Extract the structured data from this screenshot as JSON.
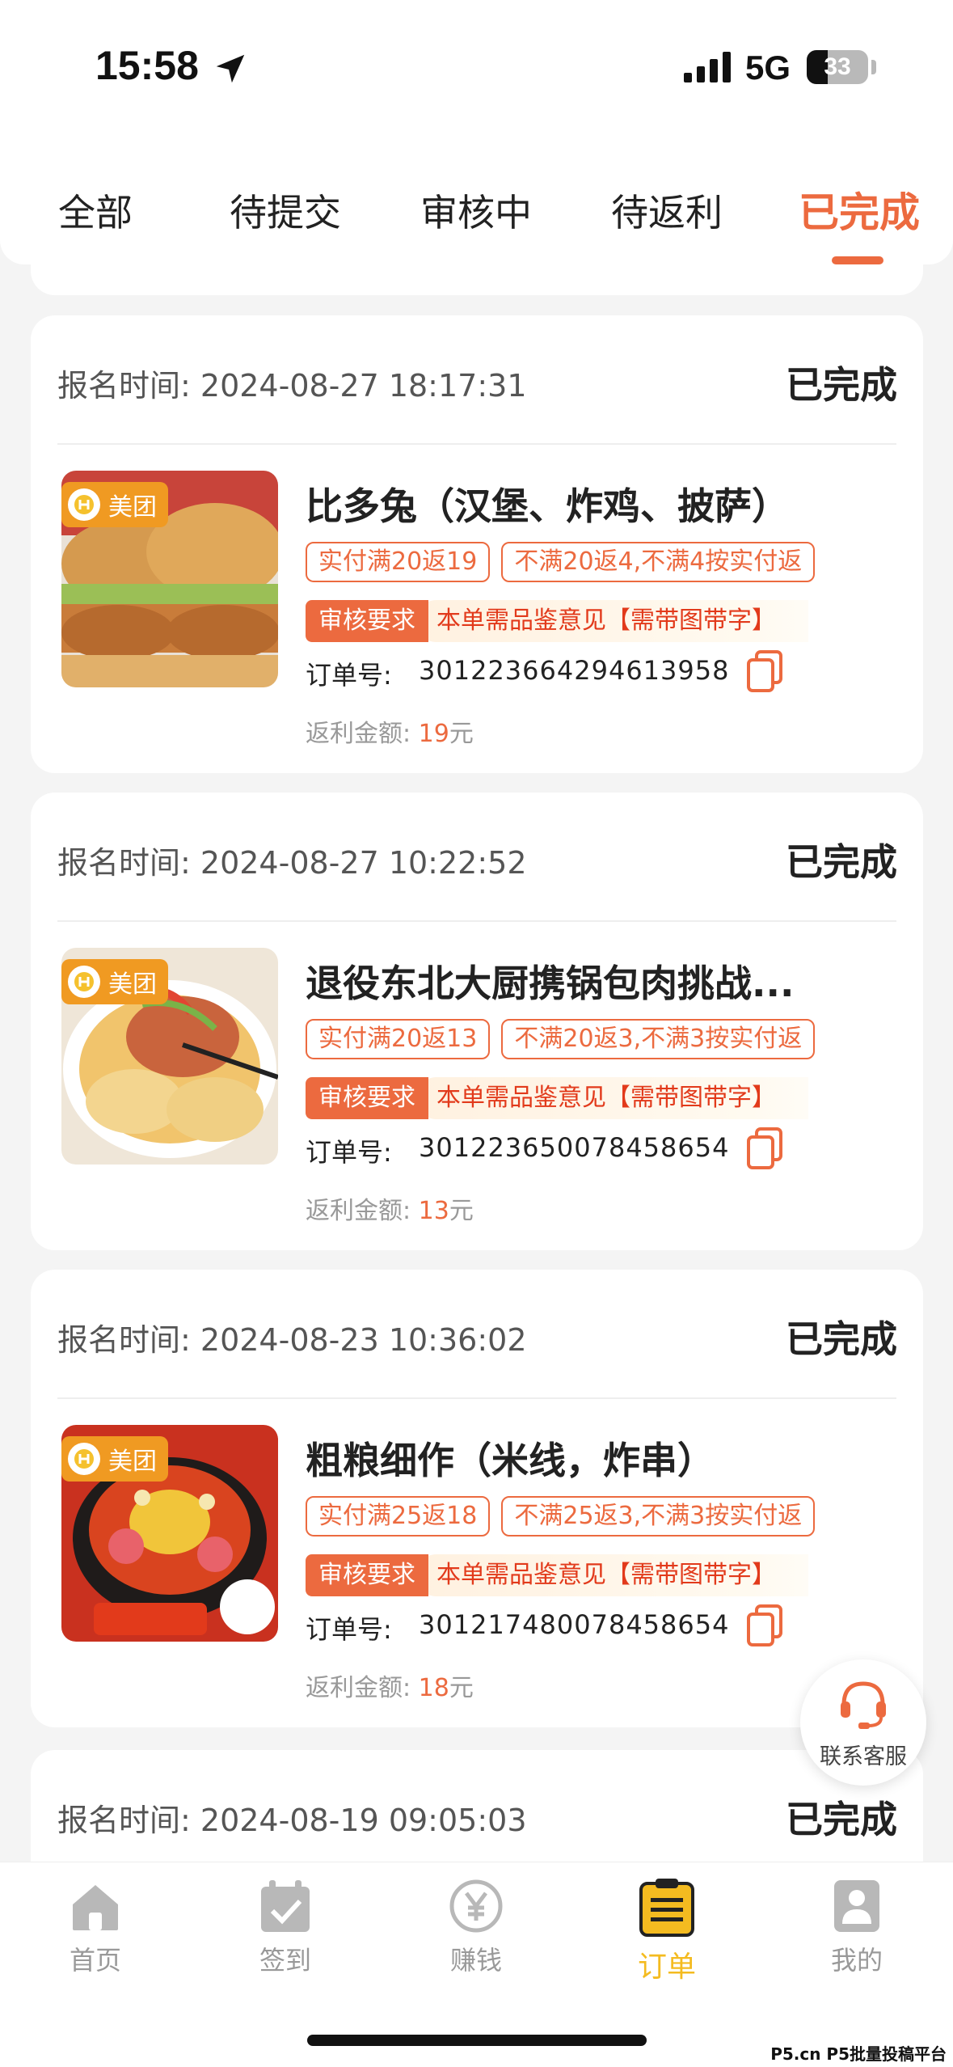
{
  "status_bar": {
    "time": "15:58",
    "network": "5G",
    "battery": "33"
  },
  "tabs": [
    {
      "label": "全部"
    },
    {
      "label": "待提交"
    },
    {
      "label": "审核中"
    },
    {
      "label": "待返利"
    },
    {
      "label": "已完成"
    }
  ],
  "active_tab": "已完成",
  "orders": [
    {
      "time_label": "报名时间:",
      "time": "2024-08-27 18:17:31",
      "status": "已完成",
      "platform": "美团",
      "title": "比多兔（汉堡、炸鸡、披萨）",
      "tag1": "实付满20返19",
      "tag2": "不满20返4,不满4按实付返",
      "req_label": "审核要求",
      "req_text": "本单需品鉴意见【需带图带字】",
      "order_label": "订单号:",
      "order_no": "301223664294613958",
      "rebate_label": "返利金额:",
      "rebate_amount": "19",
      "rebate_unit": "元"
    },
    {
      "time_label": "报名时间:",
      "time": "2024-08-27 10:22:52",
      "status": "已完成",
      "platform": "美团",
      "title": "退役东北大厨携锅包肉挑战...",
      "tag1": "实付满20返13",
      "tag2": "不满20返3,不满3按实付返",
      "req_label": "审核要求",
      "req_text": "本单需品鉴意见【需带图带字】",
      "order_label": "订单号:",
      "order_no": "301223650078458654",
      "rebate_label": "返利金额:",
      "rebate_amount": "13",
      "rebate_unit": "元"
    },
    {
      "time_label": "报名时间:",
      "time": "2024-08-23 10:36:02",
      "status": "已完成",
      "platform": "美团",
      "title": "粗粮细作（米线，炸串）",
      "tag1": "实付满25返18",
      "tag2": "不满25返3,不满3按实付返",
      "req_label": "审核要求",
      "req_text": "本单需品鉴意见【需带图带字】",
      "order_label": "订单号:",
      "order_no": "301217480078458654",
      "rebate_label": "返利金额:",
      "rebate_amount": "18",
      "rebate_unit": "元"
    },
    {
      "time_label": "报名时间:",
      "time": "2024-08-19 09:05:03",
      "status": "已完成"
    }
  ],
  "customer_service": "联系客服",
  "bottom_nav": [
    {
      "label": "首页",
      "icon": "home-icon"
    },
    {
      "label": "签到",
      "icon": "calendar-check-icon"
    },
    {
      "label": "赚钱",
      "icon": "yuan-icon"
    },
    {
      "label": "订单",
      "icon": "clipboard-icon"
    },
    {
      "label": "我的",
      "icon": "user-icon"
    }
  ],
  "watermark": "P5.cn P5批量投稿平台",
  "colors": {
    "accent": "#ec6a3f",
    "nav_active": "#f4bb20",
    "badge": "#f09a22"
  }
}
